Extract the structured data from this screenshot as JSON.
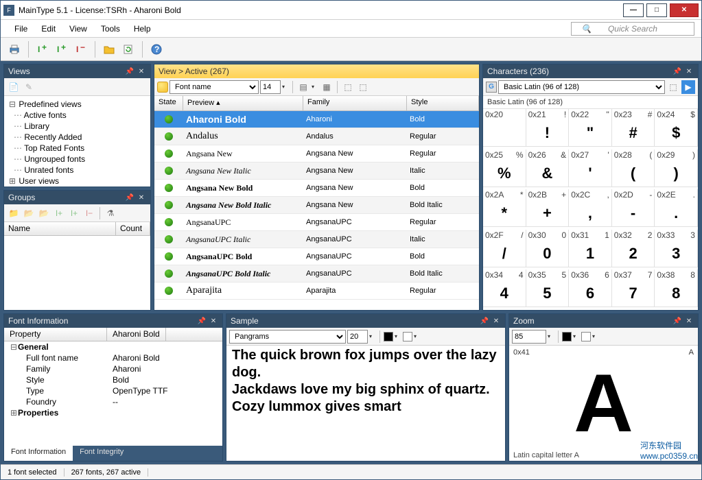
{
  "titlebar": {
    "text": "MainType 5.1 - License:TSRh - Aharoni Bold"
  },
  "menu": {
    "file": "File",
    "edit": "Edit",
    "view": "View",
    "tools": "Tools",
    "help": "Help"
  },
  "search": {
    "placeholder": "Quick Search"
  },
  "views_panel": {
    "title": "Views",
    "root": "Predefined views",
    "items": [
      "Active fonts",
      "Library",
      "Recently Added",
      "Top Rated Fonts",
      "Ungrouped fonts",
      "Unrated fonts"
    ],
    "user_views": "User views"
  },
  "groups_panel": {
    "title": "Groups",
    "col_name": "Name",
    "col_count": "Count"
  },
  "fontlist": {
    "title": "View > Active (267)",
    "sort_field": "Font name",
    "size": "14",
    "cols": {
      "state": "State",
      "preview": "Preview ▴",
      "family": "Family",
      "style": "Style"
    },
    "rows": [
      {
        "preview": "Aharoni Bold",
        "family": "Aharoni",
        "style": "Bold",
        "sel": true,
        "fs": "font-weight:900"
      },
      {
        "preview": "Andalus",
        "family": "Andalus",
        "style": "Regular",
        "fs": "font-family:Georgia,serif"
      },
      {
        "preview": "Angsana New",
        "family": "Angsana New",
        "style": "Regular",
        "fs": "font-family:'Times New Roman',serif;font-size:12px"
      },
      {
        "preview": "Angsana New Italic",
        "family": "Angsana New",
        "style": "Italic",
        "fs": "font-family:'Times New Roman',serif;font-style:italic;font-size:12px"
      },
      {
        "preview": "Angsana New Bold",
        "family": "Angsana New",
        "style": "Bold",
        "fs": "font-family:'Times New Roman',serif;font-weight:bold;font-size:12px"
      },
      {
        "preview": "Angsana New Bold Italic",
        "family": "Angsana New",
        "style": "Bold Italic",
        "fs": "font-family:'Times New Roman',serif;font-style:italic;font-weight:bold;font-size:12px"
      },
      {
        "preview": "AngsanaUPC",
        "family": "AngsanaUPC",
        "style": "Regular",
        "fs": "font-family:'Times New Roman',serif;font-size:12px"
      },
      {
        "preview": "AngsanaUPC Italic",
        "family": "AngsanaUPC",
        "style": "Italic",
        "fs": "font-family:'Times New Roman',serif;font-style:italic;font-size:12px"
      },
      {
        "preview": "AngsanaUPC Bold",
        "family": "AngsanaUPC",
        "style": "Bold",
        "fs": "font-family:'Times New Roman',serif;font-weight:bold;font-size:12px"
      },
      {
        "preview": "AngsanaUPC Bold Italic",
        "family": "AngsanaUPC",
        "style": "Bold Italic",
        "fs": "font-family:'Times New Roman',serif;font-style:italic;font-weight:bold;font-size:12px"
      },
      {
        "preview": "Aparajita",
        "family": "Aparajita",
        "style": "Regular",
        "fs": "font-family:Georgia,serif"
      }
    ]
  },
  "chars_panel": {
    "title": "Characters (236)",
    "block": "Basic Latin (96 of 128)",
    "cells": [
      {
        "c": "0x20",
        "r": "",
        "g": " "
      },
      {
        "c": "0x21",
        "r": "!",
        "g": "!"
      },
      {
        "c": "0x22",
        "r": "\"",
        "g": "\""
      },
      {
        "c": "0x23",
        "r": "#",
        "g": "#"
      },
      {
        "c": "0x24",
        "r": "$",
        "g": "$"
      },
      {
        "c": "0x25",
        "r": "%",
        "g": "%"
      },
      {
        "c": "0x26",
        "r": "&",
        "g": "&"
      },
      {
        "c": "0x27",
        "r": "'",
        "g": "'"
      },
      {
        "c": "0x28",
        "r": "(",
        "g": "("
      },
      {
        "c": "0x29",
        "r": ")",
        "g": ")"
      },
      {
        "c": "0x2A",
        "r": "*",
        "g": "*"
      },
      {
        "c": "0x2B",
        "r": "+",
        "g": "+"
      },
      {
        "c": "0x2C",
        "r": ",",
        "g": ","
      },
      {
        "c": "0x2D",
        "r": "-",
        "g": "-"
      },
      {
        "c": "0x2E",
        "r": ".",
        "g": "."
      },
      {
        "c": "0x2F",
        "r": "/",
        "g": "/"
      },
      {
        "c": "0x30",
        "r": "0",
        "g": "0"
      },
      {
        "c": "0x31",
        "r": "1",
        "g": "1"
      },
      {
        "c": "0x32",
        "r": "2",
        "g": "2"
      },
      {
        "c": "0x33",
        "r": "3",
        "g": "3"
      },
      {
        "c": "0x34",
        "r": "4",
        "g": "4"
      },
      {
        "c": "0x35",
        "r": "5",
        "g": "5"
      },
      {
        "c": "0x36",
        "r": "6",
        "g": "6"
      },
      {
        "c": "0x37",
        "r": "7",
        "g": "7"
      },
      {
        "c": "0x38",
        "r": "8",
        "g": "8"
      }
    ]
  },
  "fontinfo": {
    "title": "Font Information",
    "col_prop": "Property",
    "col_val": "Aharoni Bold",
    "general": "General",
    "properties_label": "Properties",
    "rows": [
      {
        "p": "Full font name",
        "v": "Aharoni Bold"
      },
      {
        "p": "Family",
        "v": "Aharoni"
      },
      {
        "p": "Style",
        "v": "Bold"
      },
      {
        "p": "Type",
        "v": "OpenType TTF"
      },
      {
        "p": "Foundry",
        "v": "--"
      }
    ],
    "tab1": "Font Information",
    "tab2": "Font Integrity"
  },
  "sample": {
    "title": "Sample",
    "mode": "Pangrams",
    "size": "20",
    "text": "The quick brown fox jumps over the lazy dog.\nJackdaws love my big sphinx of quartz.\nCozy lummox gives smart"
  },
  "zoom": {
    "title": "Zoom",
    "size": "85",
    "code": "0x41",
    "code_r": "A",
    "glyph": "A",
    "label": "Latin capital letter A"
  },
  "status": {
    "sel": "1 font selected",
    "count": "267 fonts, 267 active"
  },
  "watermark": {
    "l1": "河东软件园",
    "l2": "www.pc0359.cn"
  }
}
